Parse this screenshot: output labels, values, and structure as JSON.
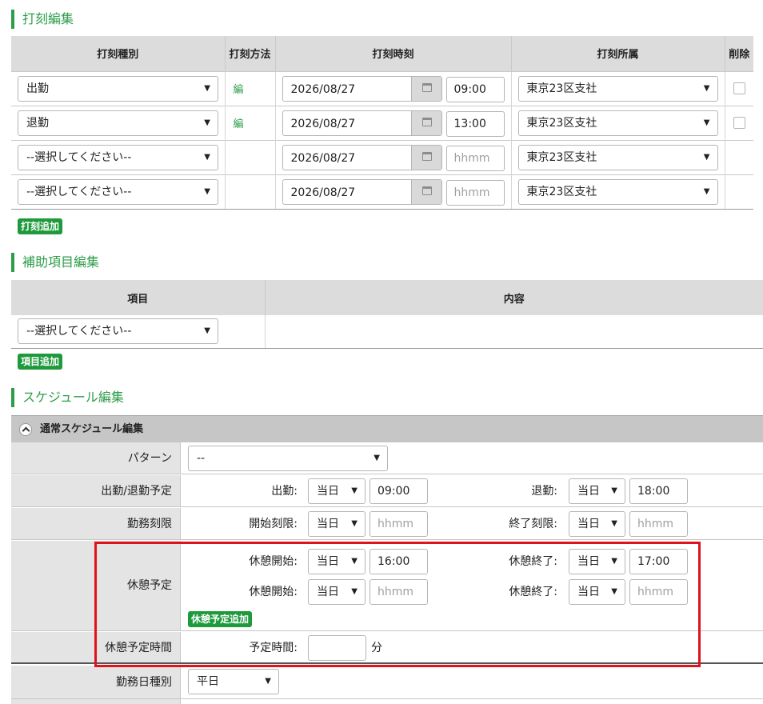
{
  "stamp_section": {
    "title": "打刻編集",
    "headers": [
      "打刻種別",
      "打刻方法",
      "打刻時刻",
      "打刻所属",
      "削除"
    ],
    "rows": [
      {
        "type": "出勤",
        "method": "編",
        "date": "2026/08/27",
        "time": "09:00",
        "time_placeholder": "",
        "affiliation": "東京23区支社",
        "has_delete": true
      },
      {
        "type": "退勤",
        "method": "編",
        "date": "2026/08/27",
        "time": "13:00",
        "time_placeholder": "",
        "affiliation": "東京23区支社",
        "has_delete": true
      },
      {
        "type": "--選択してください--",
        "method": "",
        "date": "2026/08/27",
        "time": "",
        "time_placeholder": "hhmm",
        "affiliation": "東京23区支社",
        "has_delete": false
      },
      {
        "type": "--選択してください--",
        "method": "",
        "date": "2026/08/27",
        "time": "",
        "time_placeholder": "hhmm",
        "affiliation": "東京23区支社",
        "has_delete": false
      }
    ],
    "add_button": "打刻追加"
  },
  "aux_section": {
    "title": "補助項目編集",
    "headers": [
      "項目",
      "内容"
    ],
    "row": {
      "item": "--選択してください--"
    },
    "add_button": "項目追加"
  },
  "schedule_section": {
    "title": "スケジュール編集",
    "panel_title": "通常スケジュール編集",
    "pattern": {
      "label": "パターン",
      "value": "--"
    },
    "attendance": {
      "label": "出勤/退勤予定",
      "in_label": "出勤:",
      "in_day": "当日",
      "in_time": "09:00",
      "out_label": "退勤:",
      "out_day": "当日",
      "out_time": "18:00"
    },
    "limit": {
      "label": "勤務刻限",
      "start_label": "開始刻限:",
      "start_day": "当日",
      "start_placeholder": "hhmm",
      "end_label": "終了刻限:",
      "end_day": "当日",
      "end_placeholder": "hhmm"
    },
    "break": {
      "label": "休憩予定",
      "rows": [
        {
          "start_label": "休憩開始:",
          "start_day": "当日",
          "start_time": "16:00",
          "start_placeholder": "",
          "end_label": "休憩終了:",
          "end_day": "当日",
          "end_time": "17:00",
          "end_placeholder": ""
        },
        {
          "start_label": "休憩開始:",
          "start_day": "当日",
          "start_time": "",
          "start_placeholder": "hhmm",
          "end_label": "休憩終了:",
          "end_day": "当日",
          "end_time": "",
          "end_placeholder": "hhmm"
        }
      ],
      "add_button": "休憩予定追加"
    },
    "break_time": {
      "label": "休憩予定時間",
      "inner_label": "予定時間:",
      "value": "",
      "unit": "分"
    },
    "workday": {
      "label": "勤務日種別",
      "value": "平日"
    }
  },
  "icons": {
    "calendar": "calendar-icon",
    "collapse": "chevron-up-icon",
    "dropdown": "caret-down-icon"
  },
  "colors": {
    "accent": "#2e9d4a",
    "button": "#1e9a3c",
    "highlight": "#e0121b"
  }
}
